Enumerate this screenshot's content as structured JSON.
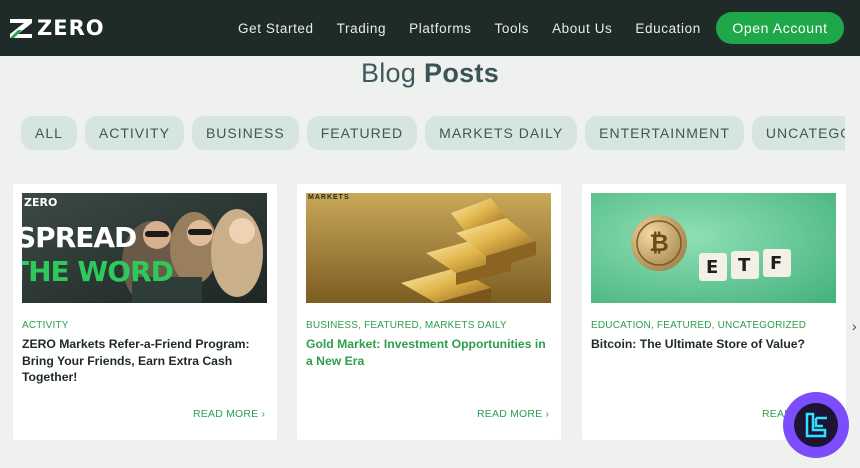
{
  "brand": {
    "name": "ZERO",
    "accent": "#1fa84a",
    "header_bg": "#1f2b29"
  },
  "nav": {
    "items": [
      "Get Started",
      "Trading",
      "Platforms",
      "Tools",
      "About Us",
      "Education"
    ],
    "cta": "Open Account"
  },
  "page": {
    "title_light": "Blog",
    "title_bold": "Posts"
  },
  "filters": [
    "ALL",
    "ACTIVITY",
    "BUSINESS",
    "FEATURED",
    "MARKETS DAILY",
    "ENTERTAINMENT",
    "UNCATEGORIZED"
  ],
  "posts": [
    {
      "categories": "ACTIVITY",
      "title": "ZERO Markets Refer-a-Friend Program: Bring Your Friends, Earn Extra Cash Together!",
      "read_more": "READ MORE ›",
      "image": {
        "brand": "ZERO",
        "line1": "SPREAD",
        "line2": "THE WORD"
      }
    },
    {
      "categories": "BUSINESS, FEATURED, MARKETS DAILY",
      "title": "Gold Market: Investment Opportunities in a New Era",
      "read_more": "READ MORE ›",
      "image": {
        "tag": "MARKETS"
      }
    },
    {
      "categories": "EDUCATION, FEATURED, UNCATEGORIZED",
      "title": "Bitcoin: The Ultimate Store of Value?",
      "read_more": "READ MORE ›",
      "image": {
        "letters": [
          "E",
          "T",
          "F"
        ]
      }
    }
  ],
  "icons": {
    "logo": "zero-logo-icon",
    "badge": "corner-badge-icon",
    "bitcoin": "bitcoin-coin-icon"
  }
}
